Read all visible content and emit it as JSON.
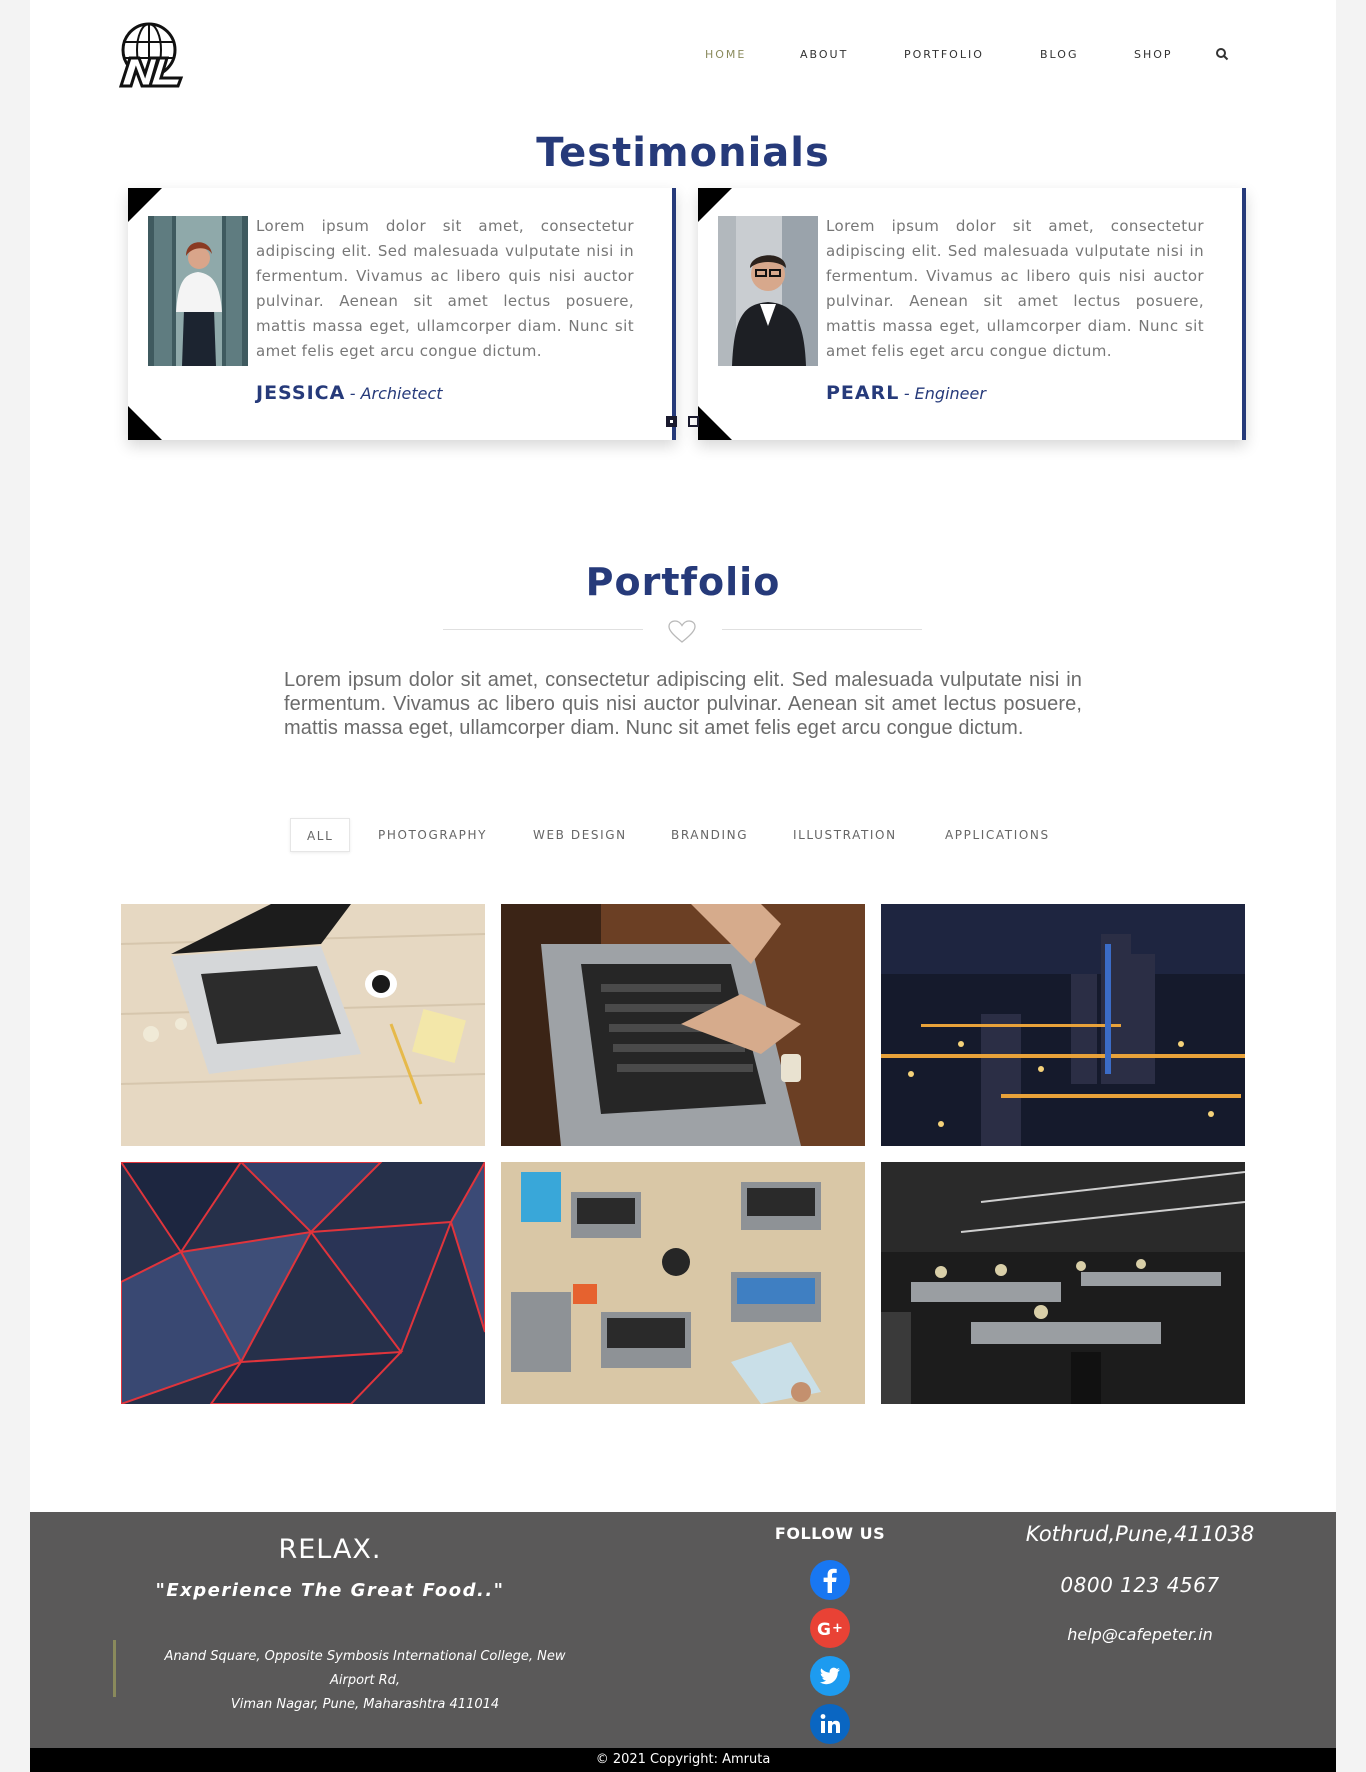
{
  "header": {
    "logo_text": "NL",
    "nav": [
      {
        "label": "HOME",
        "active": true
      },
      {
        "label": "ABOUT",
        "active": false
      },
      {
        "label": "PORTFOLIO",
        "active": false
      },
      {
        "label": "BLOG",
        "active": false
      },
      {
        "label": "SHOP",
        "active": false
      }
    ],
    "search_icon": "search-icon"
  },
  "testimonials": {
    "title": "Testimonials",
    "items": [
      {
        "quote": "Lorem ipsum dolor sit amet, consectetur adipiscing elit. Sed malesuada vulputate nisi in fermentum. Vivamus ac libero quis nisi auctor pulvinar. Aenean sit amet lectus posuere, mattis massa eget, ullamcorper diam. Nunc sit amet felis eget arcu congue dictum.",
        "name": "JESSICA",
        "role": "- Archietect"
      },
      {
        "quote": "Lorem ipsum dolor sit amet, consectetur adipiscing elit. Sed malesuada vulputate nisi in fermentum. Vivamus ac libero quis nisi auctor pulvinar. Aenean sit amet lectus posuere, mattis massa eget, ullamcorper diam. Nunc sit amet felis eget arcu congue dictum.",
        "name": "PEARL",
        "role": "- Engineer"
      }
    ],
    "active_page": 1,
    "page_count": 2
  },
  "portfolio": {
    "title": "Portfolio",
    "description": "Lorem ipsum dolor sit amet, consectetur adipiscing elit. Sed malesuada vulputate nisi in fermentum. Vivamus ac libero quis nisi auctor pulvinar. Aenean sit amet lectus posuere, mattis massa eget, ullamcorper diam. Nunc sit amet felis eget arcu congue dictum.",
    "filters": [
      {
        "label": "ALL",
        "active": true
      },
      {
        "label": "PHOTOGRAPHY",
        "active": false
      },
      {
        "label": "WEB DESIGN",
        "active": false
      },
      {
        "label": "BRANDING",
        "active": false
      },
      {
        "label": "ILLUSTRATION",
        "active": false
      },
      {
        "label": "APPLICATIONS",
        "active": false
      }
    ]
  },
  "footer": {
    "relax": "RELAX.",
    "tagline": "\"Experience The Great Food..\"",
    "address_line1": "Anand Square, Opposite Symbosis International College, New Airport Rd,",
    "address_line2": "Viman Nagar, Pune, Maharashtra 411014",
    "follow_label": "FOLLOW US",
    "social": [
      "facebook-icon",
      "google-plus-icon",
      "twitter-icon",
      "linkedin-icon"
    ],
    "city": "Kothrud,Pune,411038",
    "phone": "0800 123 4567",
    "email": "help@cafepeter.in",
    "copyright": "© 2021 Copyright: Amruta"
  },
  "colors": {
    "brand_navy": "#263a7a",
    "nav_active": "#8a8a5c",
    "footer_bg": "#5a5959",
    "facebook": "#1877f2",
    "google_plus": "#e94235",
    "twitter": "#1d9bf0",
    "linkedin": "#0a66c2"
  }
}
